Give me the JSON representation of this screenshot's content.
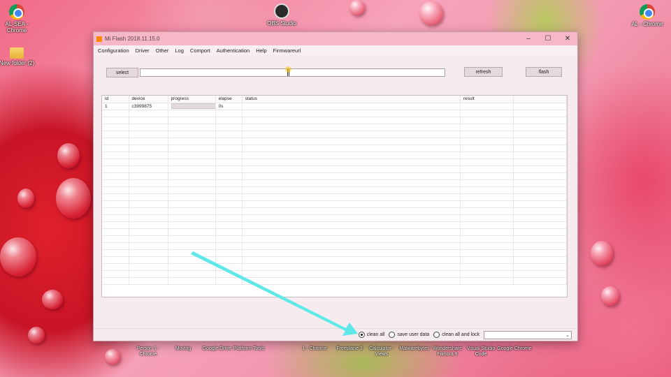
{
  "desktop": {
    "icons_left": [
      {
        "label": "AL-SEA - Chrome",
        "icon": "chrome-icon"
      },
      {
        "label": "New folder (2)",
        "icon": "folder-icon"
      }
    ],
    "icon_top_center": {
      "label": "OBS Studio",
      "icon": "obs-icon"
    },
    "icon_right": {
      "label": "AL - Chrome",
      "icon": "chrome-icon"
    },
    "taskbar_icons": [
      "Person 1 - Chrome",
      "Moving",
      "Google Drive",
      "Platform-Tools",
      "1 - Chrome",
      "Freeplane 3",
      "Calculator - Views",
      "Malwarebytes",
      "Wondershare Filmora 9",
      "Visual Studio Code",
      "Google Chrome"
    ]
  },
  "window": {
    "title": "Mi Flash 2018.11.15.0",
    "controls": {
      "minimize": "–",
      "maximize": "☐",
      "close": "✕"
    },
    "menu": [
      "Configuration",
      "Driver",
      "Other",
      "Log",
      "Comport",
      "Authentication",
      "Help",
      "Firmwareurl"
    ],
    "toolbar": {
      "select_label": "select",
      "path_value": "",
      "refresh_label": "refresh",
      "flash_label": "flash"
    },
    "table": {
      "columns": [
        "id",
        "device",
        "progress",
        "elapse",
        "status",
        "result"
      ],
      "rows": [
        {
          "id": "1",
          "device": "c3999875",
          "progress": 0,
          "elapse": "0s",
          "status": "",
          "result": ""
        }
      ]
    },
    "bottom": {
      "options": [
        {
          "label": "clean all",
          "selected": true
        },
        {
          "label": "save user data",
          "selected": false
        },
        {
          "label": "clean all and lock",
          "selected": false
        }
      ],
      "combo_value": ""
    }
  },
  "colors": {
    "arrow": "#5ee8e8",
    "titlebar": "#f6b8c6"
  }
}
